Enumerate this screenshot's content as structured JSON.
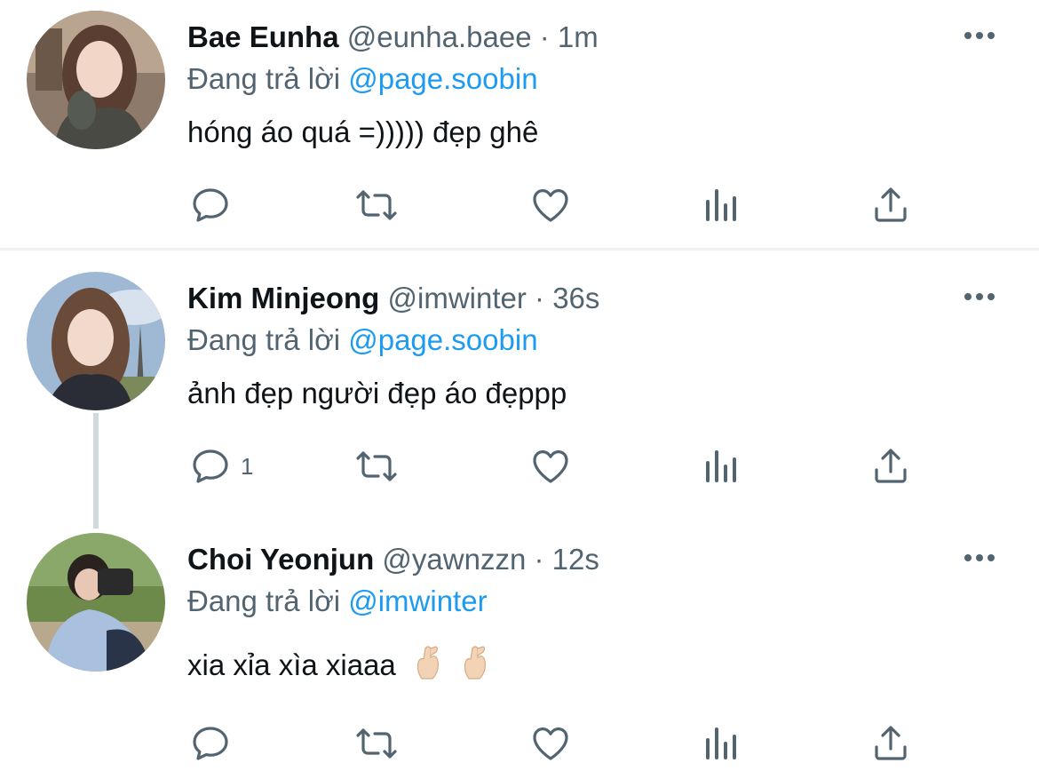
{
  "tweets": [
    {
      "name": "Bae Eunha",
      "handle": "@eunha.baee",
      "dot": "·",
      "time": "1m",
      "replying_prefix": "Đang trả lời",
      "replying_to": "@page.soobin",
      "text": "hóng áo quá =))))) đẹp ghê",
      "reply_count": ""
    },
    {
      "name": "Kim Minjeong",
      "handle": "@imwinter",
      "dot": "·",
      "time": "36s",
      "replying_prefix": "Đang trả lời",
      "replying_to": "@page.soobin",
      "text": "ảnh đẹp người đẹp áo đẹppp",
      "reply_count": "1"
    },
    {
      "name": "Choi Yeonjun",
      "handle": "@yawnzzn",
      "dot": "·",
      "time": "12s",
      "replying_prefix": "Đang trả lời",
      "replying_to": "@imwinter",
      "text": "xia xỉa xìa xiaaa",
      "emojis": [
        "🫰🏻",
        "🫰🏻"
      ],
      "reply_count": ""
    }
  ],
  "icons": {
    "reply": "reply-icon",
    "retweet": "retweet-icon",
    "like": "like-icon",
    "views": "views-icon",
    "share": "share-icon",
    "more": "more-icon"
  },
  "colors": {
    "text": "#0f1419",
    "secondary": "#536471",
    "accent": "#1d9bf0",
    "divider": "#eff3f4",
    "thread_line": "#cfd9de"
  }
}
